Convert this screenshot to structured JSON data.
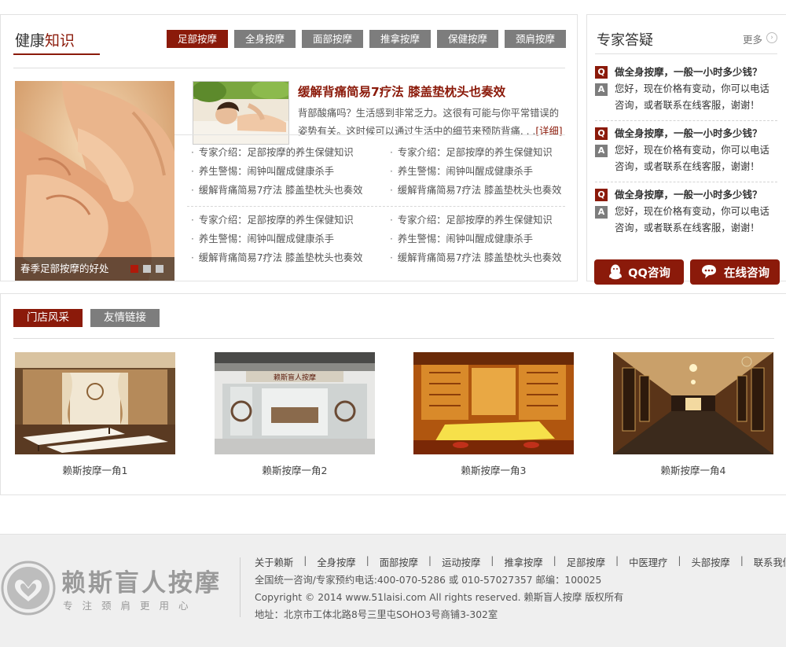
{
  "knowledge": {
    "title_main": "健康",
    "title_accent": "知识",
    "tabs": [
      "足部按摩",
      "全身按摩",
      "面部按摩",
      "推拿按摩",
      "保健按摩",
      "颈肩按摩"
    ],
    "active_tab": "足部按摩",
    "slide_caption": "春季足部按摩的好处",
    "feature": {
      "title": "缓解背痛简易7疗法  膝盖垫枕头也奏效",
      "desc": "背部酸痛吗？生活感到非常乏力。这很有可能与你平常错误的姿势有关。这时候可以通过生活中的细节来预防背痛. . .",
      "more": "[详细]"
    },
    "list_group1_left": [
      "专家介绍：足部按摩的养生保健知识",
      "养生警惕：闹钟叫醒成健康杀手",
      "缓解背痛简易7疗法  膝盖垫枕头也奏效"
    ],
    "list_group1_right": [
      "专家介绍：足部按摩的养生保健知识",
      "养生警惕：闹钟叫醒成健康杀手",
      "缓解背痛简易7疗法  膝盖垫枕头也奏效"
    ],
    "list_group2_left": [
      "专家介绍：足部按摩的养生保健知识",
      "养生警惕：闹钟叫醒成健康杀手",
      "缓解背痛简易7疗法  膝盖垫枕头也奏效"
    ],
    "list_group2_right": [
      "专家介绍：足部按摩的养生保健知识",
      "养生警惕：闹钟叫醒成健康杀手",
      "缓解背痛简易7疗法  膝盖垫枕头也奏效"
    ]
  },
  "expert": {
    "title": "专家答疑",
    "more": "更多",
    "qa": [
      {
        "q": "做全身按摩，一般一小时多少钱？",
        "a": "您好，现在价格有变动，你可以电话咨询，或者联系在线客服，谢谢！"
      },
      {
        "q": "做全身按摩，一般一小时多少钱？",
        "a": "您好，现在价格有变动，你可以电话咨询，或者联系在线客服，谢谢！"
      },
      {
        "q": "做全身按摩，一般一小时多少钱？",
        "a": "您好，现在价格有变动，你可以电话咨询，或者联系在线客服，谢谢！"
      }
    ],
    "badge_q": "Q",
    "badge_a": "A",
    "qq_button": "QQ咨询",
    "online_button": "在线咨询"
  },
  "store": {
    "tabs": [
      "门店风采",
      "友情链接"
    ],
    "shops": [
      "赖斯按摩一角1",
      "赖斯按摩一角2",
      "赖斯按摩一角3",
      "赖斯按摩一角4"
    ],
    "sign_text": "赖斯盲人按摩"
  },
  "footer": {
    "logo_name": "赖斯盲人按摩",
    "logo_slogan": "专注颈肩更用心",
    "nav": [
      "关于赖斯",
      "全身按摩",
      "面部按摩",
      "运动按摩",
      "推拿按摩",
      "足部按摩",
      "中医理疗",
      "头部按摩",
      "联系我们"
    ],
    "line1": "全国统一咨询/专家预约电话:400-070-5286 或 010-57027357 邮编：100025",
    "line2": "Copyright © 2014 www.51laisi.com All rights reserved. 赖斯盲人按摩 版权所有",
    "line3": "地址：北京市工体北路8号三里屯SOHO3号商铺3-302室"
  },
  "colors": {
    "accent": "#8b1a0a",
    "tab_gray": "#7d7d7d",
    "footer_bg": "#efefef"
  }
}
